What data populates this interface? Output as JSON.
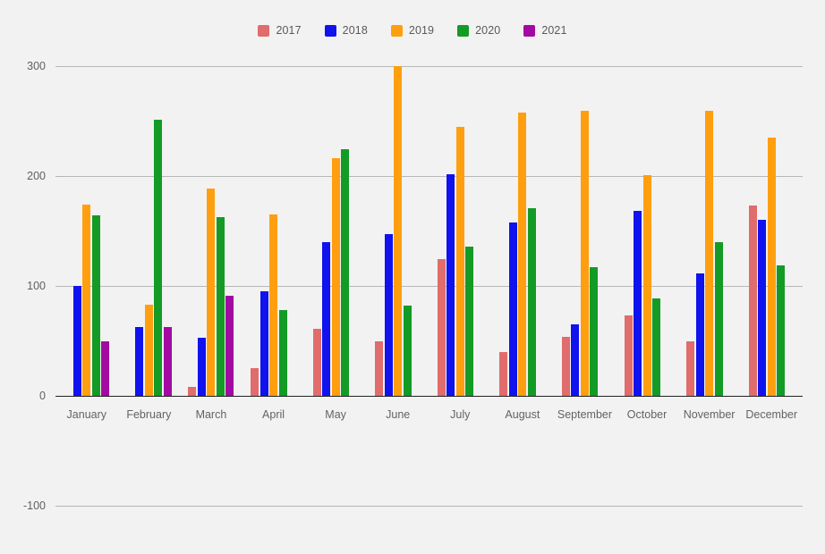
{
  "chart_data": {
    "type": "bar",
    "title": "",
    "xlabel": "",
    "ylabel": "",
    "ylim": [
      -100,
      300
    ],
    "yticks": [
      300,
      200,
      100,
      0,
      -100
    ],
    "grid": true,
    "legend_position": "top-center",
    "categories": [
      "January",
      "February",
      "March",
      "April",
      "May",
      "June",
      "July",
      "August",
      "September",
      "October",
      "November",
      "December"
    ],
    "series": [
      {
        "name": "2017",
        "color": "#e06c6c",
        "values": [
          0,
          0,
          8,
          25,
          61,
          50,
          124,
          40,
          54,
          73,
          50,
          173
        ]
      },
      {
        "name": "2018",
        "color": "#1013ee",
        "values": [
          100,
          63,
          53,
          95,
          140,
          147,
          202,
          158,
          65,
          168,
          111,
          160
        ]
      },
      {
        "name": "2019",
        "color": "#ff9f0f",
        "values": [
          174,
          83,
          189,
          165,
          216,
          300,
          245,
          258,
          259,
          201,
          259,
          235
        ]
      },
      {
        "name": "2020",
        "color": "#139b26",
        "values": [
          164,
          251,
          163,
          78,
          224,
          82,
          136,
          171,
          117,
          89,
          140,
          119
        ]
      },
      {
        "name": "2021",
        "color": "#a20ba2",
        "values": [
          50,
          63,
          91,
          0,
          0,
          0,
          0,
          0,
          0,
          0,
          0,
          0
        ]
      }
    ],
    "colors": {
      "background": "#f2f2f2",
      "gridline": "#b7b7b7",
      "axis": "#222222",
      "tick_text": "#606060"
    }
  },
  "legend": {
    "items": [
      {
        "label": "2017",
        "color": "#e06c6c",
        "swatch": "legend-swatch-2017"
      },
      {
        "label": "2018",
        "color": "#1013ee",
        "swatch": "legend-swatch-2018"
      },
      {
        "label": "2019",
        "color": "#ff9f0f",
        "swatch": "legend-swatch-2019"
      },
      {
        "label": "2020",
        "color": "#139b26",
        "swatch": "legend-swatch-2020"
      },
      {
        "label": "2021",
        "color": "#a20ba2",
        "swatch": "legend-swatch-2021"
      }
    ]
  },
  "axis": {
    "y_tick_labels": [
      "300",
      "200",
      "100",
      "0",
      "-100"
    ],
    "x_tick_labels": [
      "January",
      "February",
      "March",
      "April",
      "May",
      "June",
      "July",
      "August",
      "September",
      "October",
      "November",
      "December"
    ]
  }
}
